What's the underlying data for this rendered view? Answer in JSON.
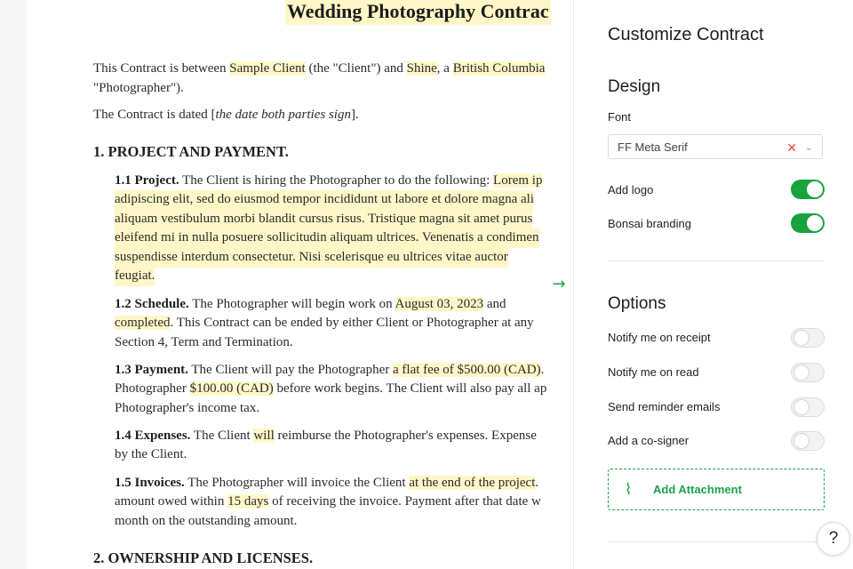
{
  "document": {
    "title": "Wedding Photography Contrac",
    "intro": {
      "t1": "This Contract is between ",
      "client": "Sample Client",
      "t2": " (the \"Client\") and ",
      "name": "Shine",
      "t3": ", a ",
      "region": "British Columbia",
      "line2": "\"Photographer\")."
    },
    "dated": {
      "t1": "The Contract is dated [",
      "italic": "the date both parties sign",
      "t2": "]."
    },
    "section1_title": "1. PROJECT AND PAYMENT.",
    "s11": {
      "label": "1.1 Project.",
      "t1": " The Client is hiring the Photographer to do the following: ",
      "hl1": "Lorem ip",
      "line2": "adipiscing elit, sed do eiusmod tempor incididunt ut labore et dolore magna ali",
      "line3": "aliquam vestibulum morbi blandit cursus risus. Tristique magna sit amet purus",
      "line4": "eleifend mi in nulla posuere sollicitudin aliquam ultrices. Venenatis a condimen",
      "line5": "suspendisse interdum consectetur. Nisi scelerisque eu ultrices vitae auctor",
      "line6": "feugiat."
    },
    "s12": {
      "label": "1.2 Schedule.",
      "t1": " The Photographer will begin work on ",
      "date": "August 03, 2023",
      "t2": " and",
      "hl2": "completed",
      "t3": ". This Contract can be ended by either Client or Photographer at any",
      "line3": "Section 4, Term and Termination."
    },
    "s13": {
      "label": "1.3 Payment.",
      "t1": " The Client will pay the Photographer ",
      "fee": "a flat fee of $500.00 (CAD)",
      "t2": ".",
      "l2a": "Photographer ",
      "deposit": "$100.00 (CAD)",
      "l2b": " before work begins. The Client will also pay all ap",
      "line3": "Photographer's income tax."
    },
    "s14": {
      "label": "1.4 Expenses.",
      "t1": " The Client ",
      "will": "will",
      "t2": " reimburse the Photographer's expenses. Expense",
      "line2": "by the Client."
    },
    "s15": {
      "label": "1.5 Invoices.",
      "t1": " The Photographer will invoice the Client ",
      "when": "at the end of the project",
      "t2": ".",
      "l2a": "amount owed within ",
      "days": "15 days",
      "l2b": " of receiving the invoice. Payment after that date w",
      "line3": "month on the outstanding amount."
    },
    "section2_title": "2. OWNERSHIP AND LICENSES."
  },
  "panel": {
    "title": "Customize Contract",
    "design_heading": "Design",
    "font_label": "Font",
    "font_value": "FF Meta Serif",
    "add_logo": "Add logo",
    "bonsai_branding": "Bonsai branding",
    "options_heading": "Options",
    "notify_receipt": "Notify me on receipt",
    "notify_read": "Notify me on read",
    "send_reminder": "Send reminder emails",
    "add_cosigner": "Add a co-signer",
    "add_attachment": "Add Attachment"
  },
  "toggles": {
    "add_logo": true,
    "bonsai_branding": true,
    "notify_receipt": false,
    "notify_read": false,
    "send_reminder": false,
    "add_cosigner": false
  },
  "icons": {
    "clear": "close-icon",
    "dropdown": "chevron-down-icon",
    "collapse": "arrow-right-icon",
    "attachment": "paperclip-icon",
    "help": "question-icon"
  },
  "help_label": "?",
  "colors": {
    "accent": "#18a33f",
    "highlight": "#fff7c8",
    "clear": "#e5484d"
  }
}
